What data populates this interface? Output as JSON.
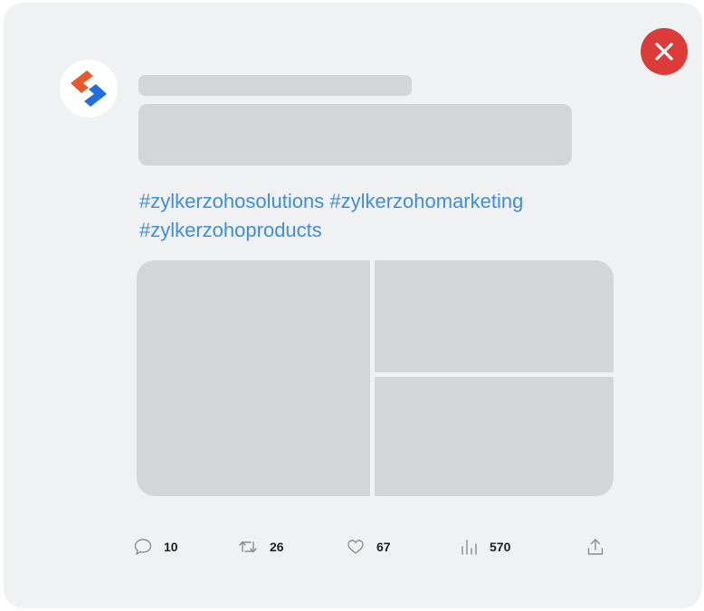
{
  "post": {
    "hashtags": [
      "#zylkerzohosolutions",
      "#zylkerzohomarketing",
      "#zylkerzohoproducts"
    ],
    "stats": {
      "replies": "10",
      "reposts": "26",
      "likes": "67",
      "views": "570"
    }
  },
  "icons": {
    "close": "close-icon",
    "avatar": "brand-logo-icon",
    "reply": "comment-icon",
    "repost": "repost-icon",
    "like": "heart-icon",
    "views": "views-chart-icon",
    "share": "share-icon"
  },
  "colors": {
    "card_bg": "#f0f1f2",
    "skeleton": "#d4d5d7",
    "hashtag": "#3d8ede",
    "close_bg": "#dc3b39",
    "logo_orange": "#e65a2e",
    "logo_blue": "#1f6fe0"
  }
}
